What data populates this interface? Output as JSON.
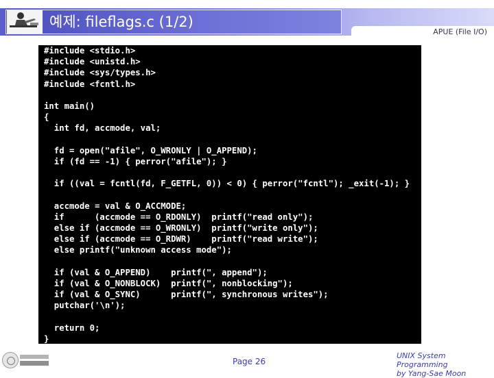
{
  "header": {
    "title": "예제: fileflags.c (1/2)",
    "subtitle": "APUE (File I/O)"
  },
  "code": {
    "lines": [
      "#include <stdio.h>",
      "#include <unistd.h>",
      "#include <sys/types.h>",
      "#include <fcntl.h>",
      "",
      "int main()",
      "{",
      "  int fd, accmode, val;",
      "",
      "  fd = open(\"afile\", O_WRONLY | O_APPEND);",
      "  if (fd == -1) { perror(\"afile\"); }",
      "",
      "  if ((val = fcntl(fd, F_GETFL, 0)) < 0) { perror(\"fcntl\"); _exit(-1); }",
      "",
      "  accmode = val & O_ACCMODE;",
      "  if      (accmode == O_RDONLY)  printf(\"read only\");",
      "  else if (accmode == O_WRONLY)  printf(\"write only\");",
      "  else if (accmode == O_RDWR)    printf(\"read write\");",
      "  else printf(\"unknown access mode\");",
      "",
      "  if (val & O_APPEND)    printf(\", append\");",
      "  if (val & O_NONBLOCK)  printf(\", nonblocking\");",
      "  if (val & O_SYNC)      printf(\", synchronous writes\");",
      "  putchar('\\n');",
      "",
      "  return 0;",
      "}"
    ]
  },
  "footer": {
    "page": "Page 26",
    "course_line1": "UNIX System Programming",
    "course_line2": "by Yang-Sae Moon"
  },
  "colors": {
    "header_accent": "#5a5cc7",
    "footer_text": "#3a3ab0",
    "code_background": "#000000",
    "code_text": "#ffffff"
  }
}
